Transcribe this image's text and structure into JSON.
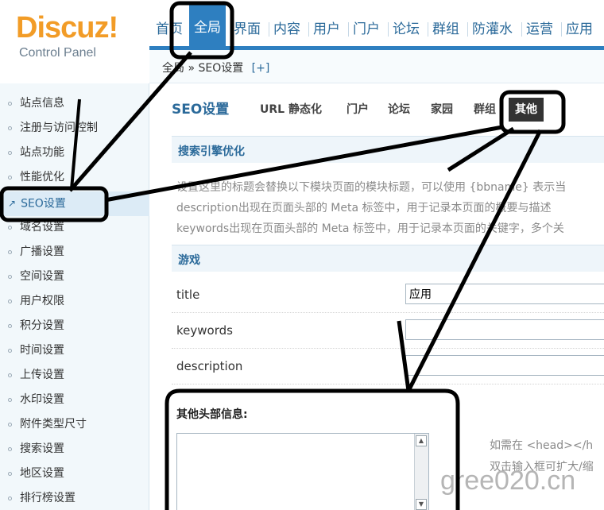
{
  "logo": {
    "brand": "Discuz!",
    "subtitle": "Control Panel"
  },
  "topnav": [
    "首页",
    "全局",
    "界面",
    "内容",
    "用户",
    "门户",
    "论坛",
    "群组",
    "防灌水",
    "运营",
    "应用"
  ],
  "breadcrumb": {
    "path": "全局 » SEO设置",
    "toggle": "[+]"
  },
  "sidebar": [
    "站点信息",
    "注册与访问控制",
    "站点功能",
    "性能优化",
    "SEO设置",
    "域名设置",
    "广播设置",
    "空间设置",
    "用户权限",
    "积分设置",
    "时间设置",
    "上传设置",
    "水印设置",
    "附件类型尺寸",
    "搜索设置",
    "地区设置",
    "排行榜设置"
  ],
  "tabs": {
    "title": "SEO设置",
    "items": [
      "URL 静态化",
      "门户",
      "论坛",
      "家园",
      "群组",
      "其他"
    ]
  },
  "section_seo": {
    "title": "搜索引擎优化",
    "desc": [
      "设置这里的标题会替换以下模块页面的模块标题，可以使用 {bbname} 表示当",
      "description出现在页面头部的 Meta 标签中，用于记录本页面的概要与描述",
      "keywords出现在页面头部的 Meta 标签中，用于记录本页面的关键字，多个关"
    ]
  },
  "section_game": {
    "title": "游戏",
    "fields": [
      {
        "label": "title",
        "value": "应用"
      },
      {
        "label": "keywords",
        "value": ""
      },
      {
        "label": "description",
        "value": ""
      }
    ]
  },
  "extra": {
    "title": "其他头部信息:",
    "hints": [
      "如需在 <head></h",
      "双击输入框可扩大/缩"
    ]
  },
  "watermark": "gree020.cn",
  "colors": {
    "accent": "#2e7fc0",
    "brand": "#f29c27",
    "annotation": "#000000"
  }
}
